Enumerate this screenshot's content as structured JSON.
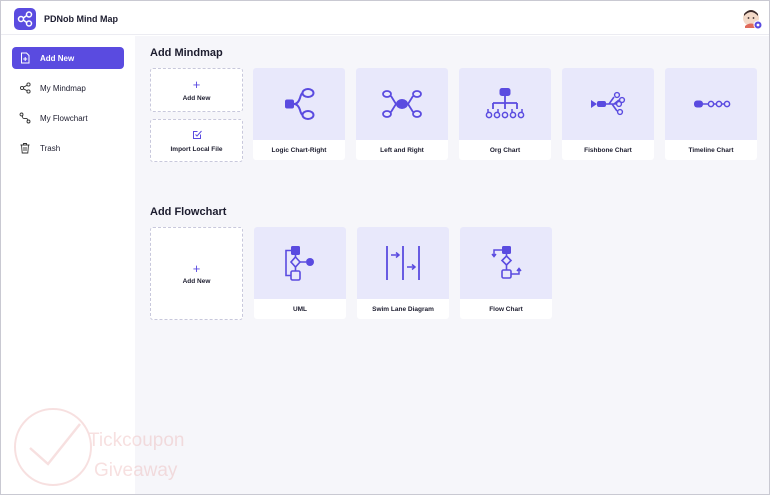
{
  "app": {
    "title": "PDNob Mind Map"
  },
  "sidebar": {
    "items": [
      {
        "label": "Add New",
        "icon": "add-file-icon",
        "active": true
      },
      {
        "label": "My Mindmap",
        "icon": "share-nodes-icon",
        "active": false
      },
      {
        "label": "My Flowchart",
        "icon": "flow-path-icon",
        "active": false
      },
      {
        "label": "Trash",
        "icon": "trash-icon",
        "active": false
      }
    ]
  },
  "mindmap": {
    "title": "Add Mindmap",
    "add_new_label": "Add New",
    "import_label": "Import Local File",
    "templates": [
      {
        "label": "Logic Chart-Right",
        "icon": "logic-chart-icon"
      },
      {
        "label": "Left and Right",
        "icon": "left-right-icon"
      },
      {
        "label": "Org Chart",
        "icon": "org-chart-icon"
      },
      {
        "label": "Fishbone Chart",
        "icon": "fishbone-icon"
      },
      {
        "label": "Timeline Chart",
        "icon": "timeline-icon"
      }
    ]
  },
  "flowchart": {
    "title": "Add Flowchart",
    "add_new_label": "Add New",
    "templates": [
      {
        "label": "UML",
        "icon": "uml-icon"
      },
      {
        "label": "Swim Lane Diagram",
        "icon": "swim-lane-icon"
      },
      {
        "label": "Flow Chart",
        "icon": "flow-chart-icon"
      }
    ]
  },
  "watermark": {
    "line1": "Tickcoupon",
    "line2": "Giveaway"
  },
  "colors": {
    "accent": "#5a4be0",
    "card_bg": "#e8e8fb",
    "main_bg": "#f6f6fa"
  }
}
